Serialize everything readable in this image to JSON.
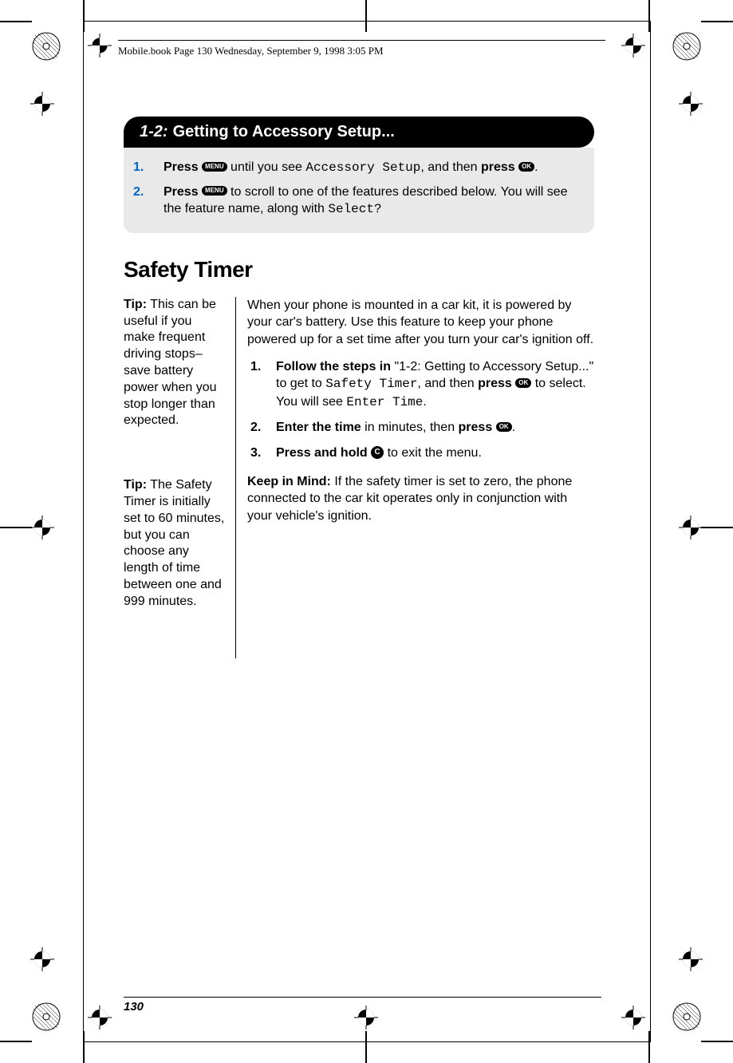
{
  "header_text": "Mobile.book  Page 130  Wednesday, September 9, 1998  3:05 PM",
  "section": {
    "number": "1-2:",
    "title": "Getting to Accessory Setup..."
  },
  "topsteps": [
    {
      "num": "1.",
      "press": "Press",
      "btn1": "MENU",
      "mid": " until you see ",
      "lcd": "Accessory Setup",
      "post": ", and then ",
      "press2": "press",
      "btn2": "OK",
      "end": "."
    },
    {
      "num": "2.",
      "press": "Press",
      "btn1": "MENU",
      "mid": " to scroll to one of the features described below. You will see the feature name, along with ",
      "lcd": "Select?"
    }
  ],
  "h2": "Safety Timer",
  "sidebar": {
    "tip1_label": "Tip:",
    "tip1_body": " This can be useful if you make frequent driving stops– save battery power when you stop longer than expected.",
    "tip2_label": "Tip:",
    "tip2_body": " The Safety Timer is initially set to 60 minutes, but you can choose any length of time between one and 999 minutes."
  },
  "main": {
    "intro": "When your phone is mounted in a car kit, it is powered by your car's battery. Use this feature to keep your phone powered up for a set time after you turn your car's ignition off.",
    "steps": [
      {
        "num": "1.",
        "bold": "Follow the steps in",
        "plain1": " \"1-2: Getting to Accessory Setup...\" to get to ",
        "lcd1": "Safety Timer",
        "plain2": ", and then ",
        "press": "press",
        "btn": "OK",
        "plain3": " to select. You will see ",
        "lcd2": "Enter Time",
        "end": "."
      },
      {
        "num": "2.",
        "bold": "Enter the time",
        "plain1": " in minutes, then ",
        "press": "press",
        "btn": "OK",
        "end": "."
      },
      {
        "num": "3.",
        "bold": "Press and hold",
        "btn": "C",
        "plain1": " to exit the menu."
      }
    ],
    "keep_label": "Keep in Mind:",
    "keep_body": " If the safety timer is set to zero, the phone connected to the car kit operates only in conjunction with your vehicle's ignition."
  },
  "pagenum": "130"
}
